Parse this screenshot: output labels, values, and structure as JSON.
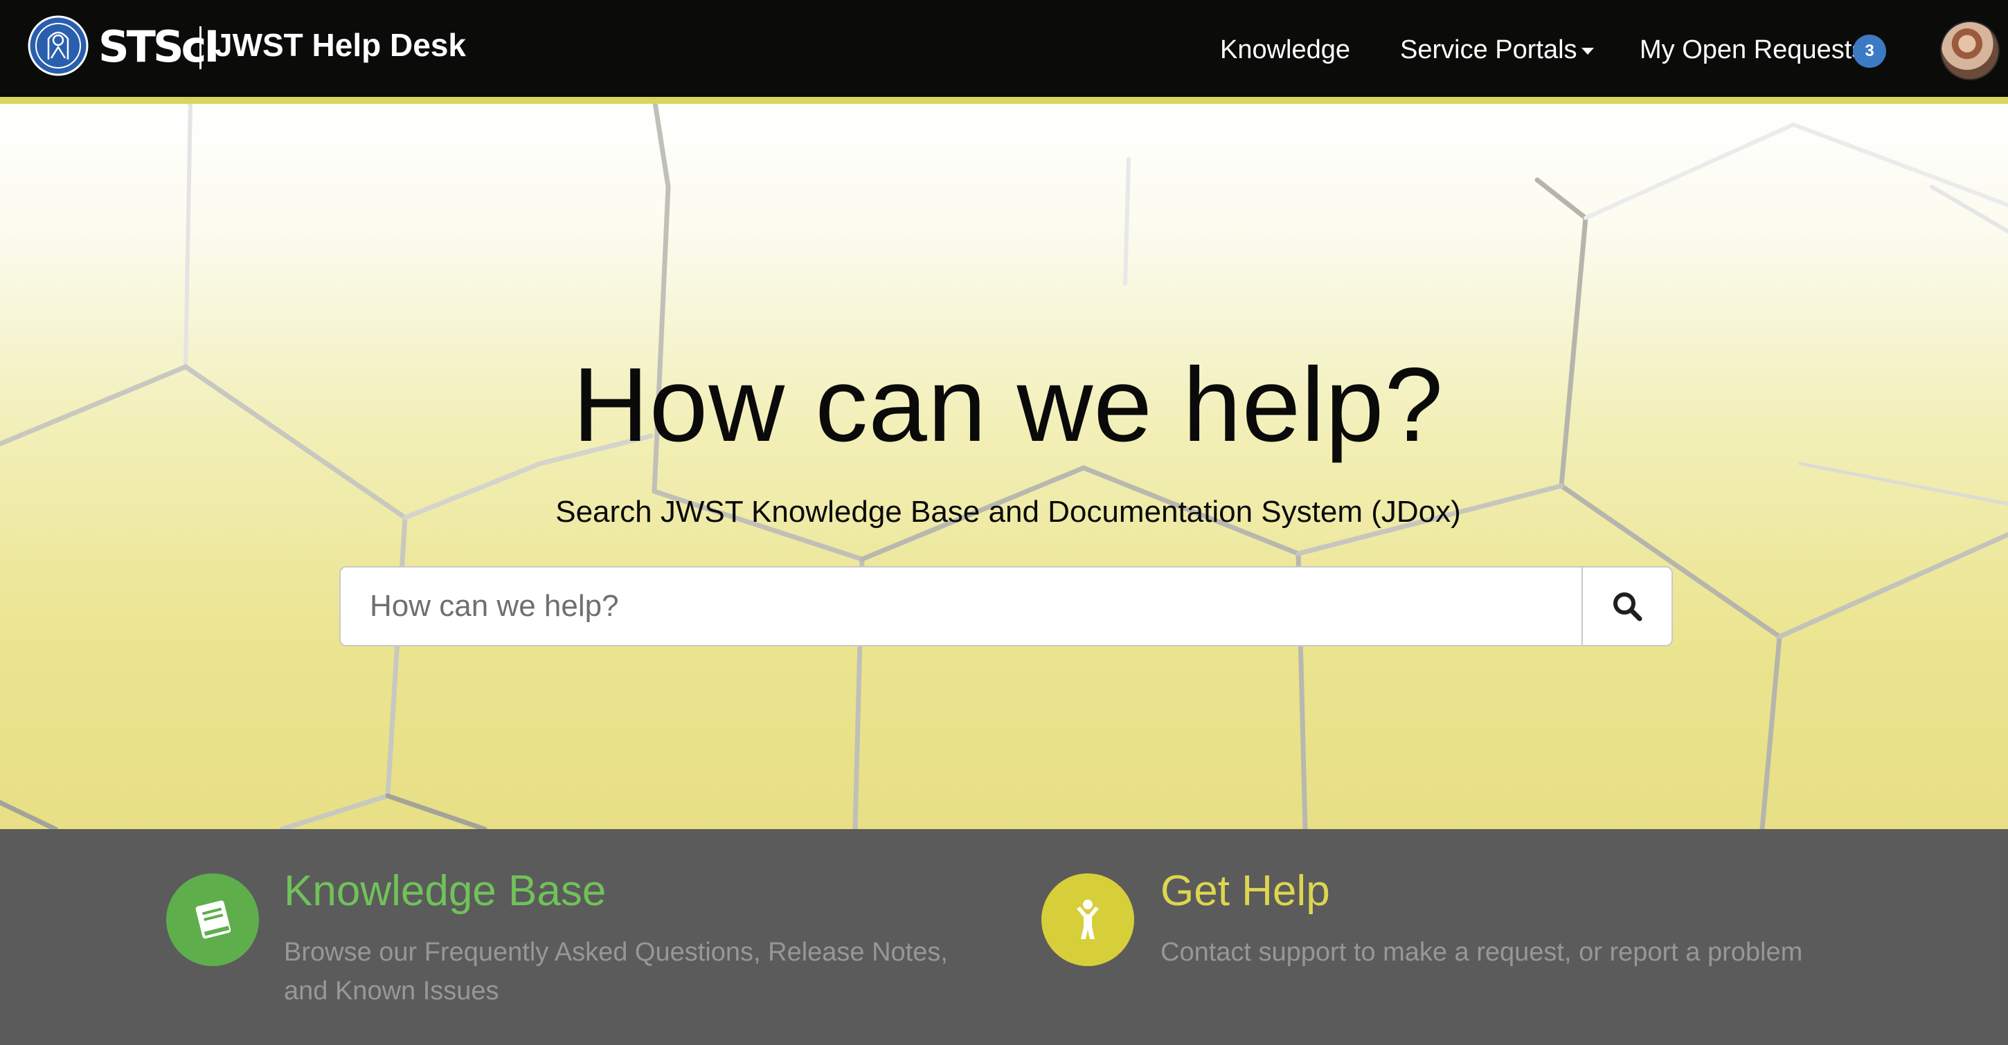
{
  "header": {
    "brand_text": "STScI",
    "site_title": "JWST Help Desk",
    "nav": {
      "knowledge": "Knowledge",
      "service_portals": "Service Portals",
      "my_open_requests": "My Open Requests",
      "open_requests_count": "3"
    },
    "accent_color": "#d9d55d"
  },
  "hero": {
    "title": "How can we help?",
    "subtitle": "Search JWST Knowledge Base and Documentation System (JDox)",
    "search_placeholder": "How can we help?"
  },
  "tiles": {
    "knowledge_base": {
      "title": "Knowledge Base",
      "description": "Browse our Frequently Asked Questions, Release Notes, and Known Issues",
      "icon": "book-icon",
      "color": "#5fae4c"
    },
    "get_help": {
      "title": "Get Help",
      "description": "Contact support to make a request, or report a problem",
      "icon": "person-icon",
      "color": "#d7cf39"
    }
  }
}
